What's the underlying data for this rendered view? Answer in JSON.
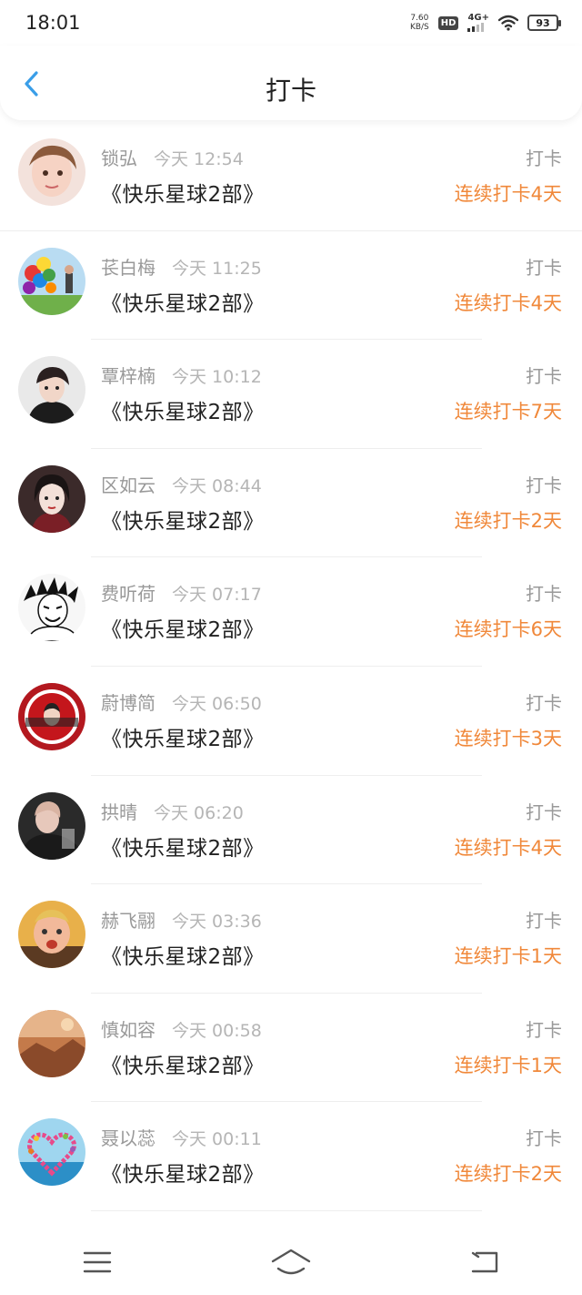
{
  "status": {
    "time": "18:01",
    "net_speed_value": "7.60",
    "net_speed_unit": "KB/S",
    "hd_label": "HD",
    "signal_label": "4G+",
    "battery": "93"
  },
  "header": {
    "title": "打卡"
  },
  "entries": [
    {
      "name": "锁弘",
      "time": "今天 12:54",
      "book": "《快乐星球2部》",
      "action": "打卡",
      "streak": "连续打卡4天"
    },
    {
      "name": "苌白梅",
      "time": "今天 11:25",
      "book": "《快乐星球2部》",
      "action": "打卡",
      "streak": "连续打卡4天"
    },
    {
      "name": "覃梓楠",
      "time": "今天 10:12",
      "book": "《快乐星球2部》",
      "action": "打卡",
      "streak": "连续打卡7天"
    },
    {
      "name": "区如云",
      "time": "今天 08:44",
      "book": "《快乐星球2部》",
      "action": "打卡",
      "streak": "连续打卡2天"
    },
    {
      "name": "费听荷",
      "time": "今天 07:17",
      "book": "《快乐星球2部》",
      "action": "打卡",
      "streak": "连续打卡6天"
    },
    {
      "name": "蔚博简",
      "time": "今天 06:50",
      "book": "《快乐星球2部》",
      "action": "打卡",
      "streak": "连续打卡3天"
    },
    {
      "name": "拱晴",
      "time": "今天 06:20",
      "book": "《快乐星球2部》",
      "action": "打卡",
      "streak": "连续打卡4天"
    },
    {
      "name": "赫飞翮",
      "time": "今天 03:36",
      "book": "《快乐星球2部》",
      "action": "打卡",
      "streak": "连续打卡1天"
    },
    {
      "name": "慎如容",
      "time": "今天 00:58",
      "book": "《快乐星球2部》",
      "action": "打卡",
      "streak": "连续打卡1天"
    },
    {
      "name": "聂以蕊",
      "time": "今天 00:11",
      "book": "《快乐星球2部》",
      "action": "打卡",
      "streak": "连续打卡2天"
    }
  ],
  "colors": {
    "accent": "#f0883a",
    "back_arrow": "#3a9ee8",
    "muted_text": "#999999"
  }
}
